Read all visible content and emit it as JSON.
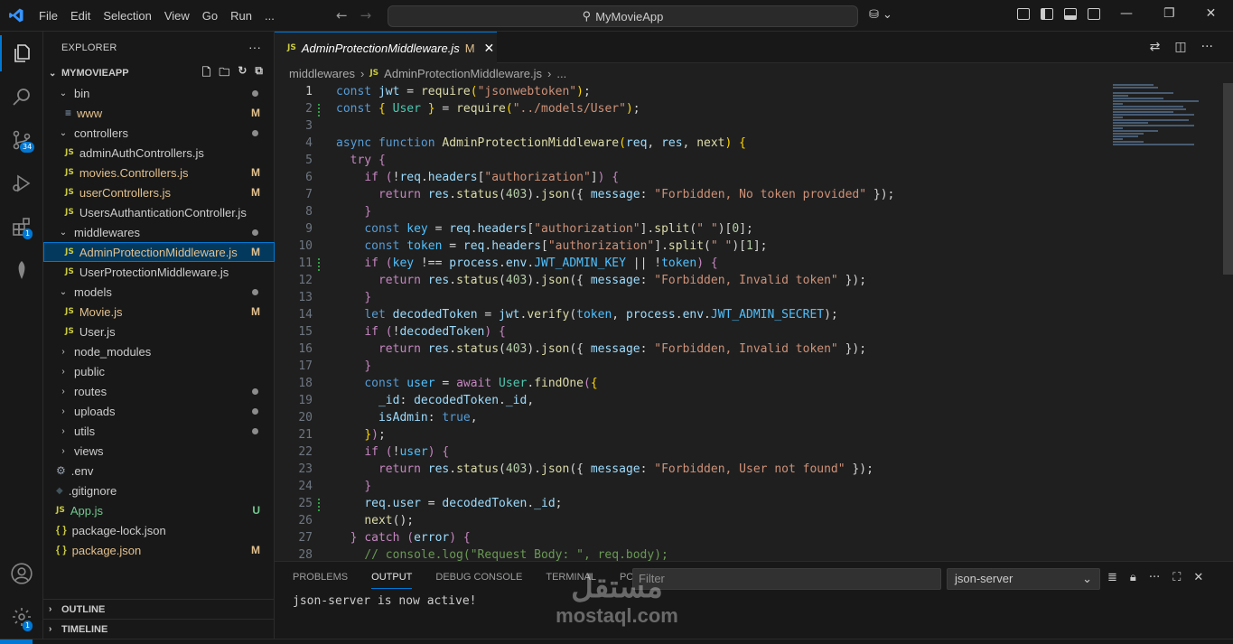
{
  "menu": [
    "File",
    "Edit",
    "Selection",
    "View",
    "Go",
    "Run",
    "..."
  ],
  "search_text": "MyMovieApp",
  "explorer": {
    "title": "EXPLORER",
    "project": "MYMOVIEAPP",
    "tree": [
      {
        "label": "bin",
        "type": "folder",
        "open": true,
        "depth": 1,
        "status": "dot"
      },
      {
        "label": "www",
        "type": "file",
        "icon": "lines",
        "depth": 2,
        "status": "M"
      },
      {
        "label": "controllers",
        "type": "folder",
        "open": true,
        "depth": 1,
        "status": "dot"
      },
      {
        "label": "adminAuthControllers.js",
        "type": "js",
        "depth": 2,
        "status": ""
      },
      {
        "label": "movies.Controllers.js",
        "type": "js",
        "depth": 2,
        "status": "M"
      },
      {
        "label": "userControllers.js",
        "type": "js",
        "depth": 2,
        "status": "M"
      },
      {
        "label": "UsersAuthanticationController.js",
        "type": "js",
        "depth": 2,
        "status": ""
      },
      {
        "label": "middlewares",
        "type": "folder",
        "open": true,
        "depth": 1,
        "status": "dot"
      },
      {
        "label": "AdminProtectionMiddleware.js",
        "type": "js",
        "depth": 2,
        "status": "M",
        "selected": true
      },
      {
        "label": "UserProtectionMiddleware.js",
        "type": "js",
        "depth": 2,
        "status": ""
      },
      {
        "label": "models",
        "type": "folder",
        "open": true,
        "depth": 1,
        "status": "dot"
      },
      {
        "label": "Movie.js",
        "type": "js",
        "depth": 2,
        "status": "M"
      },
      {
        "label": "User.js",
        "type": "js",
        "depth": 2,
        "status": ""
      },
      {
        "label": "node_modules",
        "type": "folder",
        "open": false,
        "depth": 1,
        "status": ""
      },
      {
        "label": "public",
        "type": "folder",
        "open": false,
        "depth": 1,
        "status": ""
      },
      {
        "label": "routes",
        "type": "folder",
        "open": false,
        "depth": 1,
        "status": "dot"
      },
      {
        "label": "uploads",
        "type": "folder",
        "open": false,
        "depth": 1,
        "status": "dot"
      },
      {
        "label": "utils",
        "type": "folder",
        "open": false,
        "depth": 1,
        "status": "dot"
      },
      {
        "label": "views",
        "type": "folder",
        "open": false,
        "depth": 1,
        "status": ""
      },
      {
        "label": ".env",
        "type": "gear",
        "depth": 1,
        "status": ""
      },
      {
        "label": ".gitignore",
        "type": "git",
        "depth": 1,
        "status": ""
      },
      {
        "label": "App.js",
        "type": "js",
        "depth": 1,
        "status": "U"
      },
      {
        "label": "package-lock.json",
        "type": "json",
        "depth": 1,
        "status": ""
      },
      {
        "label": "package.json",
        "type": "json",
        "depth": 1,
        "status": "M"
      }
    ],
    "outline": "OUTLINE",
    "timeline": "TIMELINE"
  },
  "activity_badges": {
    "source_control": "34",
    "extensions": "1",
    "settings": "1"
  },
  "tab": {
    "label": "AdminProtectionMiddleware.js",
    "status": "M",
    "icon": "JS"
  },
  "breadcrumb": {
    "folder": "middlewares",
    "file": "AdminProtectionMiddleware.js",
    "more": "..."
  },
  "code_lines": [
    "<span class=\"kw\">const</span> <span class=\"var\">jwt</span> = <span class=\"fn\">require</span><span class=\"br\">(</span><span class=\"str\">\"jsonwebtoken\"</span><span class=\"br\">)</span>;",
    "<span class=\"kw\">const</span> <span class=\"br\">{</span> <span class=\"cls\">User</span> <span class=\"br\">}</span> = <span class=\"fn\">require</span><span class=\"br\">(</span><span class=\"str\">\"../models/User\"</span><span class=\"br\">)</span>;",
    "",
    "<span class=\"kw\">async</span> <span class=\"kw\">function</span> <span class=\"fn\">AdminProtectionMiddleware</span><span class=\"br\">(</span><span class=\"var\">req</span>, <span class=\"var\">res</span>, <span class=\"fn\">next</span><span class=\"br\">)</span> <span class=\"br\">{</span>",
    "  <span class=\"ctl\">try</span> <span class=\"ctl\">{</span>",
    "    <span class=\"ctl\">if</span> <span class=\"ctl\">(</span>!<span class=\"var\">req</span>.<span class=\"var\">headers</span>[<span class=\"str\">\"authorization\"</span>]<span class=\"ctl\">)</span> <span class=\"ctl\">{</span>",
    "      <span class=\"ctl\">return</span> <span class=\"var\">res</span>.<span class=\"fn\">status</span>(<span class=\"num\">403</span>).<span class=\"fn\">json</span>({ <span class=\"var\">message</span>: <span class=\"str\">\"Forbidden, No token provided\"</span> });",
    "    <span class=\"ctl\">}</span>",
    "    <span class=\"kw\">const</span> <span class=\"con\">key</span> = <span class=\"var\">req</span>.<span class=\"var\">headers</span>[<span class=\"str\">\"authorization\"</span>].<span class=\"fn\">split</span>(<span class=\"str\">\" \"</span>)[<span class=\"num\">0</span>];",
    "    <span class=\"kw\">const</span> <span class=\"con\">token</span> = <span class=\"var\">req</span>.<span class=\"var\">headers</span>[<span class=\"str\">\"authorization\"</span>].<span class=\"fn\">split</span>(<span class=\"str\">\" \"</span>)[<span class=\"num\">1</span>];",
    "    <span class=\"ctl\">if</span> <span class=\"ctl\">(</span><span class=\"con\">key</span> !== <span class=\"var\">process</span>.<span class=\"var\">env</span>.<span class=\"con\">JWT_ADMIN_KEY</span> || !<span class=\"con\">token</span><span class=\"ctl\">)</span> <span class=\"ctl\">{</span>",
    "      <span class=\"ctl\">return</span> <span class=\"var\">res</span>.<span class=\"fn\">status</span>(<span class=\"num\">403</span>).<span class=\"fn\">json</span>({ <span class=\"var\">message</span>: <span class=\"str\">\"Forbidden, Invalid token\"</span> });",
    "    <span class=\"ctl\">}</span>",
    "    <span class=\"kw\">let</span> <span class=\"var\">decodedToken</span> = <span class=\"var\">jwt</span>.<span class=\"fn\">verify</span>(<span class=\"con\">token</span>, <span class=\"var\">process</span>.<span class=\"var\">env</span>.<span class=\"con\">JWT_ADMIN_SECRET</span>);",
    "    <span class=\"ctl\">if</span> <span class=\"ctl\">(</span>!<span class=\"var\">decodedToken</span><span class=\"ctl\">)</span> <span class=\"ctl\">{</span>",
    "      <span class=\"ctl\">return</span> <span class=\"var\">res</span>.<span class=\"fn\">status</span>(<span class=\"num\">403</span>).<span class=\"fn\">json</span>({ <span class=\"var\">message</span>: <span class=\"str\">\"Forbidden, Invalid token\"</span> });",
    "    <span class=\"ctl\">}</span>",
    "    <span class=\"kw\">const</span> <span class=\"con\">user</span> = <span class=\"ctl\">await</span> <span class=\"cls\">User</span>.<span class=\"fn\">findOne</span><span class=\"ctl\">(</span><span class=\"br\">{</span>",
    "      <span class=\"var\">_id</span>: <span class=\"var\">decodedToken</span>.<span class=\"var\">_id</span>,",
    "      <span class=\"var\">isAdmin</span>: <span class=\"kw\">true</span>,",
    "    <span class=\"br\">}</span><span class=\"ctl\">)</span>;",
    "    <span class=\"ctl\">if</span> <span class=\"ctl\">(</span>!<span class=\"con\">user</span><span class=\"ctl\">)</span> <span class=\"ctl\">{</span>",
    "      <span class=\"ctl\">return</span> <span class=\"var\">res</span>.<span class=\"fn\">status</span>(<span class=\"num\">403</span>).<span class=\"fn\">json</span>({ <span class=\"var\">message</span>: <span class=\"str\">\"Forbidden, User not found\"</span> });",
    "    <span class=\"ctl\">}</span>",
    "    <span class=\"var\">req</span>.<span class=\"var\">user</span> = <span class=\"var\">decodedToken</span>.<span class=\"var\">_id</span>;",
    "    <span class=\"fn\">next</span>();",
    "  <span class=\"ctl\">}</span> <span class=\"ctl\">catch</span> <span class=\"ctl\">(</span><span class=\"var\">error</span><span class=\"ctl\">)</span> <span class=\"ctl\">{</span>",
    "    <span class=\"cm\">// console.log(\"Request Body: \", req.body);</span>"
  ],
  "panel": {
    "tabs": [
      "PROBLEMS",
      "OUTPUT",
      "DEBUG CONSOLE",
      "TERMINAL",
      "PORTS"
    ],
    "active_tab": "OUTPUT",
    "filter_placeholder": "Filter",
    "channel": "json-server",
    "output_text": "json-server is now active!"
  },
  "watermark": {
    "arabic": "مستقل",
    "latin": "mostaql.com"
  }
}
